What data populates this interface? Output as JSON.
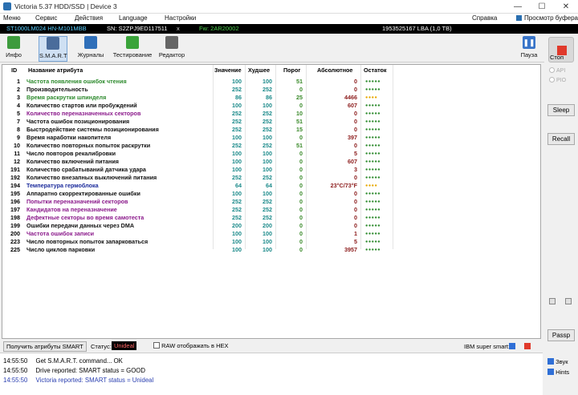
{
  "window": {
    "title": "Victoria 5.37 HDD/SSD | Device 3",
    "minimize": "—",
    "maximize": "☐",
    "close": "✕"
  },
  "menu": {
    "items": [
      "Меню",
      "Сервис",
      "Действия",
      "Language",
      "Настройки"
    ],
    "help": "Справка",
    "viewer": "Просмотр буфера"
  },
  "infobar": {
    "model": "ST1000LM024 HN-M101MBB",
    "sn": "SN: S2ZPJ9ED117511",
    "x": "x",
    "fw": "Fw: 2AR20002",
    "capacity": "1953525167 LBA (1,0 TB)"
  },
  "toolbar": {
    "info": "Инфо",
    "smart": "S.M.A.R.T",
    "journals": "Журналы",
    "testing": "Тестирование",
    "editor": "Редактор",
    "pause": "Пауза",
    "stop": "Стоп"
  },
  "table": {
    "headers": {
      "id": "ID",
      "name": "Название атрибута",
      "value": "Значение",
      "worst": "Худшее",
      "threshold": "Порог",
      "absolute": "Абсолютное",
      "remain": "Остаток"
    },
    "rows": [
      {
        "id": "1",
        "name": "Частота появления ошибок чтения",
        "value": "100",
        "worst": "100",
        "threshold": "51",
        "absolute": "0",
        "remain": "●●●●●",
        "nc": "#2e8b2e",
        "rc": "#2e8b2e"
      },
      {
        "id": "2",
        "name": "Производительность",
        "value": "252",
        "worst": "252",
        "threshold": "0",
        "absolute": "0",
        "remain": "●●●●●",
        "nc": "#111111",
        "rc": "#2e8b2e"
      },
      {
        "id": "3",
        "name": "Время раскрутки шпинделя",
        "value": "86",
        "worst": "86",
        "threshold": "25",
        "absolute": "4466",
        "remain": "●●●●",
        "nc": "#2e8b2e",
        "rc": "#e8a800"
      },
      {
        "id": "4",
        "name": "Количество стартов или пробуждений",
        "value": "100",
        "worst": "100",
        "threshold": "0",
        "absolute": "607",
        "remain": "●●●●●",
        "nc": "#111111",
        "rc": "#2e8b2e"
      },
      {
        "id": "5",
        "name": "Количество переназначенных секторов",
        "value": "252",
        "worst": "252",
        "threshold": "10",
        "absolute": "0",
        "remain": "●●●●●",
        "nc": "#8b1a8b",
        "rc": "#2e8b2e"
      },
      {
        "id": "7",
        "name": "Частота ошибок позиционирования",
        "value": "252",
        "worst": "252",
        "threshold": "51",
        "absolute": "0",
        "remain": "●●●●●",
        "nc": "#111111",
        "rc": "#2e8b2e"
      },
      {
        "id": "8",
        "name": "Быстродействие системы позиционирования",
        "value": "252",
        "worst": "252",
        "threshold": "15",
        "absolute": "0",
        "remain": "●●●●●",
        "nc": "#111111",
        "rc": "#2e8b2e"
      },
      {
        "id": "9",
        "name": "Время наработки накопителя",
        "value": "100",
        "worst": "100",
        "threshold": "0",
        "absolute": "397",
        "remain": "●●●●●",
        "nc": "#111111",
        "rc": "#2e8b2e"
      },
      {
        "id": "10",
        "name": "Количество повторных попыток раскрутки",
        "value": "252",
        "worst": "252",
        "threshold": "51",
        "absolute": "0",
        "remain": "●●●●●",
        "nc": "#111111",
        "rc": "#2e8b2e"
      },
      {
        "id": "11",
        "name": "Число повторов рекалибровки",
        "value": "100",
        "worst": "100",
        "threshold": "0",
        "absolute": "5",
        "remain": "●●●●●",
        "nc": "#111111",
        "rc": "#2e8b2e"
      },
      {
        "id": "12",
        "name": "Количество включений питания",
        "value": "100",
        "worst": "100",
        "threshold": "0",
        "absolute": "607",
        "remain": "●●●●●",
        "nc": "#111111",
        "rc": "#2e8b2e"
      },
      {
        "id": "191",
        "name": "Количество срабатываний датчика удара",
        "value": "100",
        "worst": "100",
        "threshold": "0",
        "absolute": "3",
        "remain": "●●●●●",
        "nc": "#111111",
        "rc": "#2e8b2e"
      },
      {
        "id": "192",
        "name": "Количество внезапных выключений питания",
        "value": "252",
        "worst": "252",
        "threshold": "0",
        "absolute": "0",
        "remain": "●●●●●",
        "nc": "#111111",
        "rc": "#2e8b2e"
      },
      {
        "id": "194",
        "name": "Температура гермоблока",
        "value": "64",
        "worst": "64",
        "threshold": "0",
        "absolute": "23°C/73°F",
        "remain": "●●●●",
        "nc": "#1a2a9b",
        "rc": "#e8a800"
      },
      {
        "id": "195",
        "name": "Аппаратно скорректированные ошибки",
        "value": "100",
        "worst": "100",
        "threshold": "0",
        "absolute": "0",
        "remain": "●●●●●",
        "nc": "#111111",
        "rc": "#2e8b2e"
      },
      {
        "id": "196",
        "name": "Попытки переназначений секторов",
        "value": "252",
        "worst": "252",
        "threshold": "0",
        "absolute": "0",
        "remain": "●●●●●",
        "nc": "#8b1a8b",
        "rc": "#2e8b2e"
      },
      {
        "id": "197",
        "name": "Кандидатов на переназначение",
        "value": "252",
        "worst": "252",
        "threshold": "0",
        "absolute": "0",
        "remain": "●●●●●",
        "nc": "#8b1a8b",
        "rc": "#2e8b2e"
      },
      {
        "id": "198",
        "name": "Дефектные секторы во время самотеста",
        "value": "252",
        "worst": "252",
        "threshold": "0",
        "absolute": "0",
        "remain": "●●●●●",
        "nc": "#8b1a8b",
        "rc": "#2e8b2e"
      },
      {
        "id": "199",
        "name": "Ошибки передачи данных через DMA",
        "value": "200",
        "worst": "200",
        "threshold": "0",
        "absolute": "0",
        "remain": "●●●●●",
        "nc": "#111111",
        "rc": "#2e8b2e"
      },
      {
        "id": "200",
        "name": "Частота ошибок записи",
        "value": "100",
        "worst": "100",
        "threshold": "0",
        "absolute": "1",
        "remain": "●●●●●",
        "nc": "#8b1a8b",
        "rc": "#2e8b2e"
      },
      {
        "id": "223",
        "name": "Число повторных попыток запарковаться",
        "value": "100",
        "worst": "100",
        "threshold": "0",
        "absolute": "5",
        "remain": "●●●●●",
        "nc": "#111111",
        "rc": "#2e8b2e"
      },
      {
        "id": "225",
        "name": "Число циклов парковки",
        "value": "100",
        "worst": "100",
        "threshold": "0",
        "absolute": "3957",
        "remain": "●●●●●",
        "nc": "#111111",
        "rc": "#2e8b2e"
      }
    ]
  },
  "side": {
    "api": "API",
    "pio": "PIO",
    "sleep": "Sleep",
    "recall": "Recall",
    "passp": "Passp",
    "sound": "Звук",
    "hints": "Hints"
  },
  "bottom": {
    "get_smart": "Получить атрибуты SMART",
    "status_label": "Статус:",
    "status_value": "Unideal",
    "raw_hex": "RAW отображать в HEX",
    "ibm": "IBM super smart:"
  },
  "log": [
    {
      "time": "14:55:50",
      "text": "Get S.M.A.R.T. command... OK",
      "color": "#111111"
    },
    {
      "time": "14:55:50",
      "text": "Drive reported: SMART status = GOOD",
      "color": "#111111"
    },
    {
      "time": "14:55:50",
      "text": "Victoria reported: SMART status = Unideal",
      "color": "#2a3fb0"
    }
  ]
}
